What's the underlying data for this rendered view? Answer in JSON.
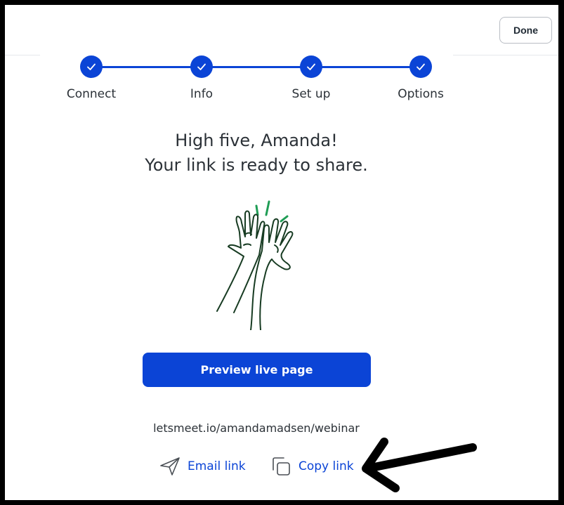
{
  "header": {
    "done_label": "Done"
  },
  "stepper": {
    "steps": [
      {
        "label": "Connect",
        "status": "complete"
      },
      {
        "label": "Info",
        "status": "complete"
      },
      {
        "label": "Set up",
        "status": "complete"
      },
      {
        "label": "Options",
        "status": "complete"
      }
    ],
    "accent_color": "#0b44d6"
  },
  "headline": {
    "line1": "High five, Amanda!",
    "line2": "Your link is ready to share."
  },
  "illustration": {
    "icon": "high-five-hands-illustration"
  },
  "actions": {
    "preview_label": "Preview live page",
    "share_url": "letsmeet.io/amandamadsen/webinar",
    "email_label": "Email link",
    "copy_label": "Copy link",
    "email_icon": "send-icon",
    "copy_icon": "copy-icon"
  },
  "annotation": {
    "icon": "arrow-pointing-left"
  },
  "colors": {
    "primary": "#0b44d6",
    "text": "#2b3137",
    "illustration_stroke": "#173b22",
    "illustration_accent": "#1f9d55"
  }
}
